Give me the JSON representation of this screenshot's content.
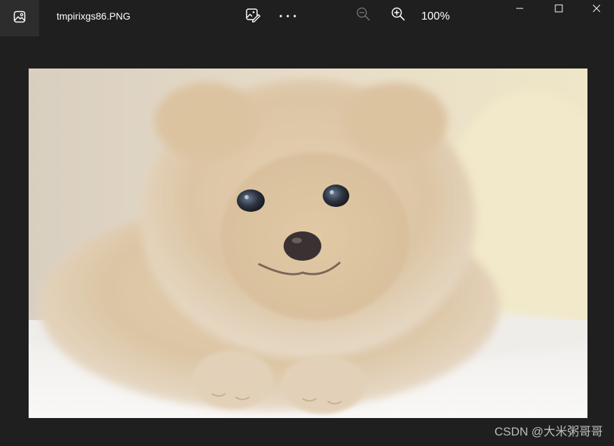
{
  "titlebar": {
    "filename": "tmpirixgs86.PNG",
    "zoom_level": "100%"
  },
  "icons": {
    "app": "photos-app-icon",
    "edit": "edit-image-icon",
    "more": "more-options-icon",
    "zoom_out": "zoom-out-icon",
    "zoom_in": "zoom-in-icon",
    "minimize": "minimize-icon",
    "maximize": "maximize-icon",
    "close": "close-icon"
  },
  "colors": {
    "background": "#1f1f1f",
    "toolbar_text": "#ffffff",
    "disabled_icon": "#6e6e6e"
  },
  "watermark": "CSDN @大米粥哥哥"
}
